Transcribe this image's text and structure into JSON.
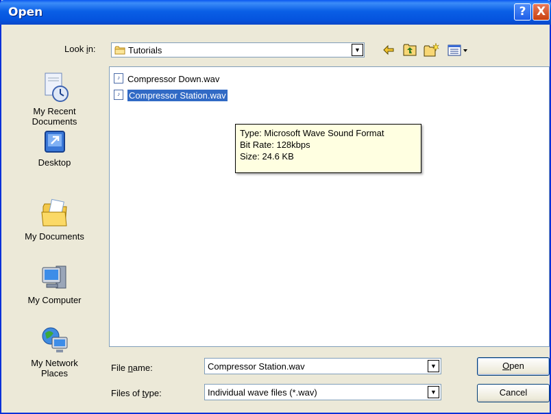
{
  "window": {
    "title": "Open",
    "help_label": "?",
    "close_label": "X"
  },
  "lookin": {
    "label_pre": "Look ",
    "label_key": "i",
    "label_post": "n:",
    "value": "Tutorials",
    "dropdown_arrow": "▼"
  },
  "toolbar": {
    "icons": [
      "back-arrow-icon",
      "up-one-level-icon",
      "create-new-folder-icon",
      "view-menu-icon"
    ]
  },
  "places": [
    {
      "id": "recent",
      "label": "My Recent\nDocuments",
      "icon": "recent-documents-icon"
    },
    {
      "id": "desktop",
      "label": "Desktop",
      "icon": "desktop-icon"
    },
    {
      "id": "documents",
      "label": "My Documents",
      "icon": "my-documents-icon"
    },
    {
      "id": "computer",
      "label": "My Computer",
      "icon": "my-computer-icon"
    },
    {
      "id": "network",
      "label": "My Network\nPlaces",
      "icon": "network-places-icon"
    }
  ],
  "files": [
    {
      "name": "Compressor Down.wav",
      "selected": false
    },
    {
      "name": "Compressor Station.wav",
      "selected": true
    }
  ],
  "tooltip": {
    "type_line": "Type: Microsoft Wave Sound Format",
    "bitrate_line": "Bit Rate: 128kbps",
    "size_line": "Size: 24.6 KB"
  },
  "filename": {
    "label_pre": "File ",
    "label_key": "n",
    "label_post": "ame:",
    "value": "Compressor Station.wav"
  },
  "filetype": {
    "label_pre": "Files of ",
    "label_key": "t",
    "label_post": "ype:",
    "value": "Individual wave files (*.wav)"
  },
  "buttons": {
    "open_key": "O",
    "open_rest": "pen",
    "cancel": "Cancel"
  },
  "colors": {
    "titlebar": "#0554de",
    "dialog_bg": "#ece9d8",
    "selection": "#316ac5",
    "tooltip_bg": "#ffffe1",
    "close_btn": "#c9400f"
  }
}
